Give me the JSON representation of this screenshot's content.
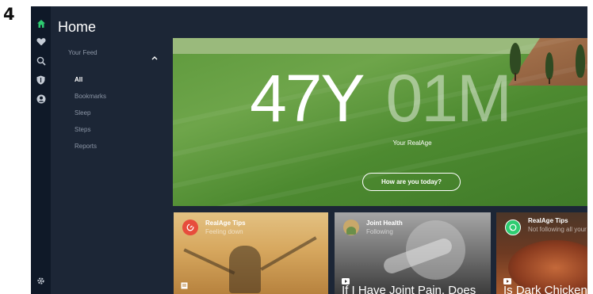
{
  "step_number": "4",
  "app": {
    "title": "Home",
    "rail_icons": [
      "home-icon",
      "heart-icon",
      "search-icon",
      "shield-icon",
      "profile-icon"
    ],
    "bottom_icon": "gear-icon",
    "accent_color": "#2ecc71"
  },
  "nav": {
    "feed_heading": "Your Feed",
    "items": [
      "All",
      "Bookmarks",
      "Sleep",
      "Steps",
      "Reports"
    ],
    "active_index": 0
  },
  "hero": {
    "age_years": "47Y",
    "age_months": "01M",
    "label": "Your RealAge",
    "button": "How are you today?"
  },
  "cards": [
    {
      "category": "RealAge Tips",
      "subtitle": "Feeling down",
      "type_icon": "article-icon",
      "headline": "",
      "avatar_color": "#e74c3c",
      "avatar_icon": "realage-icon"
    },
    {
      "category": "Joint Health",
      "subtitle": "Following",
      "type_icon": "video-icon",
      "headline": "If I Have Joint Pain, Does",
      "avatar_color": "#c9a86a",
      "avatar_icon": "thumbnail-icon"
    },
    {
      "category": "RealAge Tips",
      "subtitle": "Not following all your",
      "type_icon": "video-icon",
      "headline": "Is Dark Chicken M",
      "avatar_color": "#2ecc71",
      "avatar_icon": "chat-icon"
    }
  ]
}
